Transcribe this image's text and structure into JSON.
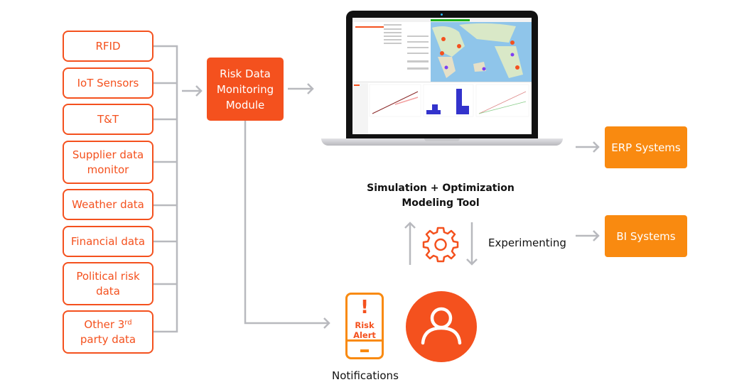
{
  "sources": [
    {
      "label": "RFID"
    },
    {
      "label": "IoT Sensors"
    },
    {
      "label": "T&T"
    },
    {
      "label": "Supplier data monitor",
      "line1": "Supplier data",
      "line2": "monitor"
    },
    {
      "label": "Weather data"
    },
    {
      "label": "Financial data"
    },
    {
      "label": "Political risk data",
      "line1": "Political risk",
      "line2": "data"
    },
    {
      "label": "Other 3rd party data",
      "line1a": "Other 3",
      "sup": "rd",
      "line2": "party data"
    }
  ],
  "module": {
    "line1": "Risk Data",
    "line2": "Monitoring",
    "line3": "Module"
  },
  "tool": {
    "line1": "Simulation + Optimization",
    "line2": "Modeling Tool"
  },
  "experimenting": "Experimenting",
  "outputs": [
    {
      "label": "ERP Systems"
    },
    {
      "label": "BI Systems"
    }
  ],
  "alert": {
    "mark": "!",
    "line1": "Risk",
    "line2": "Alert"
  },
  "notifications": "Notifications",
  "colors": {
    "primary": "#f4511e",
    "secondary": "#f98a10",
    "connector": "#b8b9be"
  }
}
